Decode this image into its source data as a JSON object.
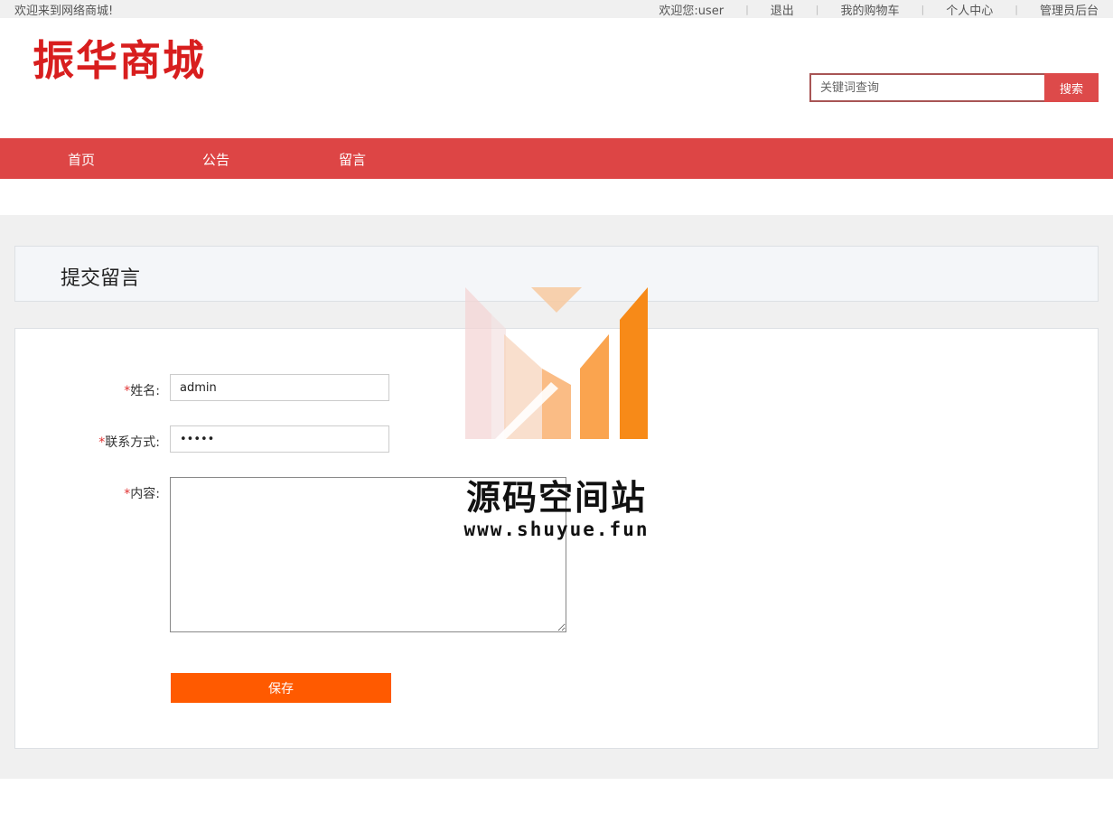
{
  "topbar": {
    "welcome": "欢迎来到网络商城!",
    "greeting": "欢迎您:user",
    "logout": "退出",
    "cart": "我的购物车",
    "profile": "个人中心",
    "admin": "管理员后台"
  },
  "header": {
    "logo": "振华商城",
    "search_placeholder": "关键词查询",
    "search_button": "搜索"
  },
  "nav": {
    "items": [
      {
        "label": "首页"
      },
      {
        "label": "公告"
      },
      {
        "label": "留言"
      }
    ]
  },
  "page": {
    "title": "提交留言"
  },
  "form": {
    "name_label": "姓名:",
    "name_value": "admin",
    "contact_label": "联系方式:",
    "contact_value": "•••••",
    "content_label": "内容:",
    "content_value": "",
    "required_mark": "*",
    "save_button": "保存"
  },
  "watermark": {
    "text": "源码空间站",
    "url": "www.shuyue.fun"
  },
  "colors": {
    "brand_red": "#dd4545",
    "logo_red": "#d81e1e",
    "save_orange": "#ff5a00"
  }
}
